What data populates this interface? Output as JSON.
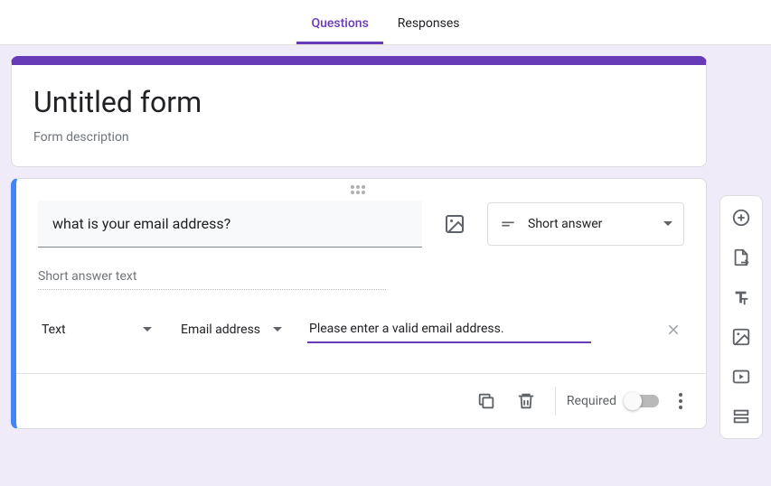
{
  "tabs": {
    "questions": "Questions",
    "responses": "Responses",
    "active": "questions"
  },
  "header": {
    "title": "Untitled form",
    "description": "Form description"
  },
  "question": {
    "title": "what is your email address?",
    "type_label": "Short answer",
    "answer_placeholder": "Short answer text",
    "validation": {
      "kind": "Text",
      "subkind": "Email address",
      "message": "Please enter a valid email address."
    },
    "required_label": "Required",
    "required": false
  },
  "icons": {
    "image": "image-icon",
    "short_answer": "short-answer-icon",
    "chevron": "chevron-down-icon",
    "close": "close-icon",
    "duplicate": "duplicate-icon",
    "delete": "delete-icon",
    "more": "more-icon",
    "add": "add-circle-icon",
    "import": "import-icon",
    "text": "text-icon",
    "add_image": "add-image-icon",
    "video": "video-icon",
    "section": "section-icon"
  }
}
